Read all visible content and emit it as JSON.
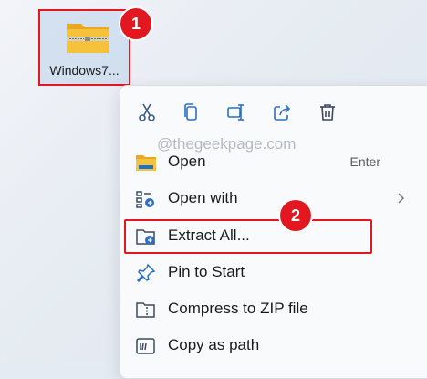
{
  "desktop": {
    "file_label": "Windows7...",
    "file_icon": "zip-folder-icon"
  },
  "steps": [
    "1",
    "2"
  ],
  "watermark": "@thegeekpage.com",
  "toolbar": [
    {
      "name": "cut",
      "icon": "scissors-icon"
    },
    {
      "name": "copy",
      "icon": "copy-icon"
    },
    {
      "name": "rename",
      "icon": "rename-icon"
    },
    {
      "name": "share",
      "icon": "share-icon"
    },
    {
      "name": "delete",
      "icon": "trash-icon"
    }
  ],
  "menu": {
    "items": [
      {
        "label": "Open",
        "accel": "Enter",
        "icon": "folder-icon"
      },
      {
        "label": "Open with",
        "icon": "open-with-icon",
        "submenu": true
      },
      {
        "label": "Extract All...",
        "icon": "extract-icon"
      },
      {
        "label": "Pin to Start",
        "icon": "pin-icon"
      },
      {
        "label": "Compress to ZIP file",
        "icon": "zip-icon"
      },
      {
        "label": "Copy as path",
        "icon": "copy-path-icon"
      }
    ]
  },
  "colors": {
    "highlight": "#e3171f",
    "folder": "#f7c23b",
    "accent": "#1f6fd1"
  }
}
